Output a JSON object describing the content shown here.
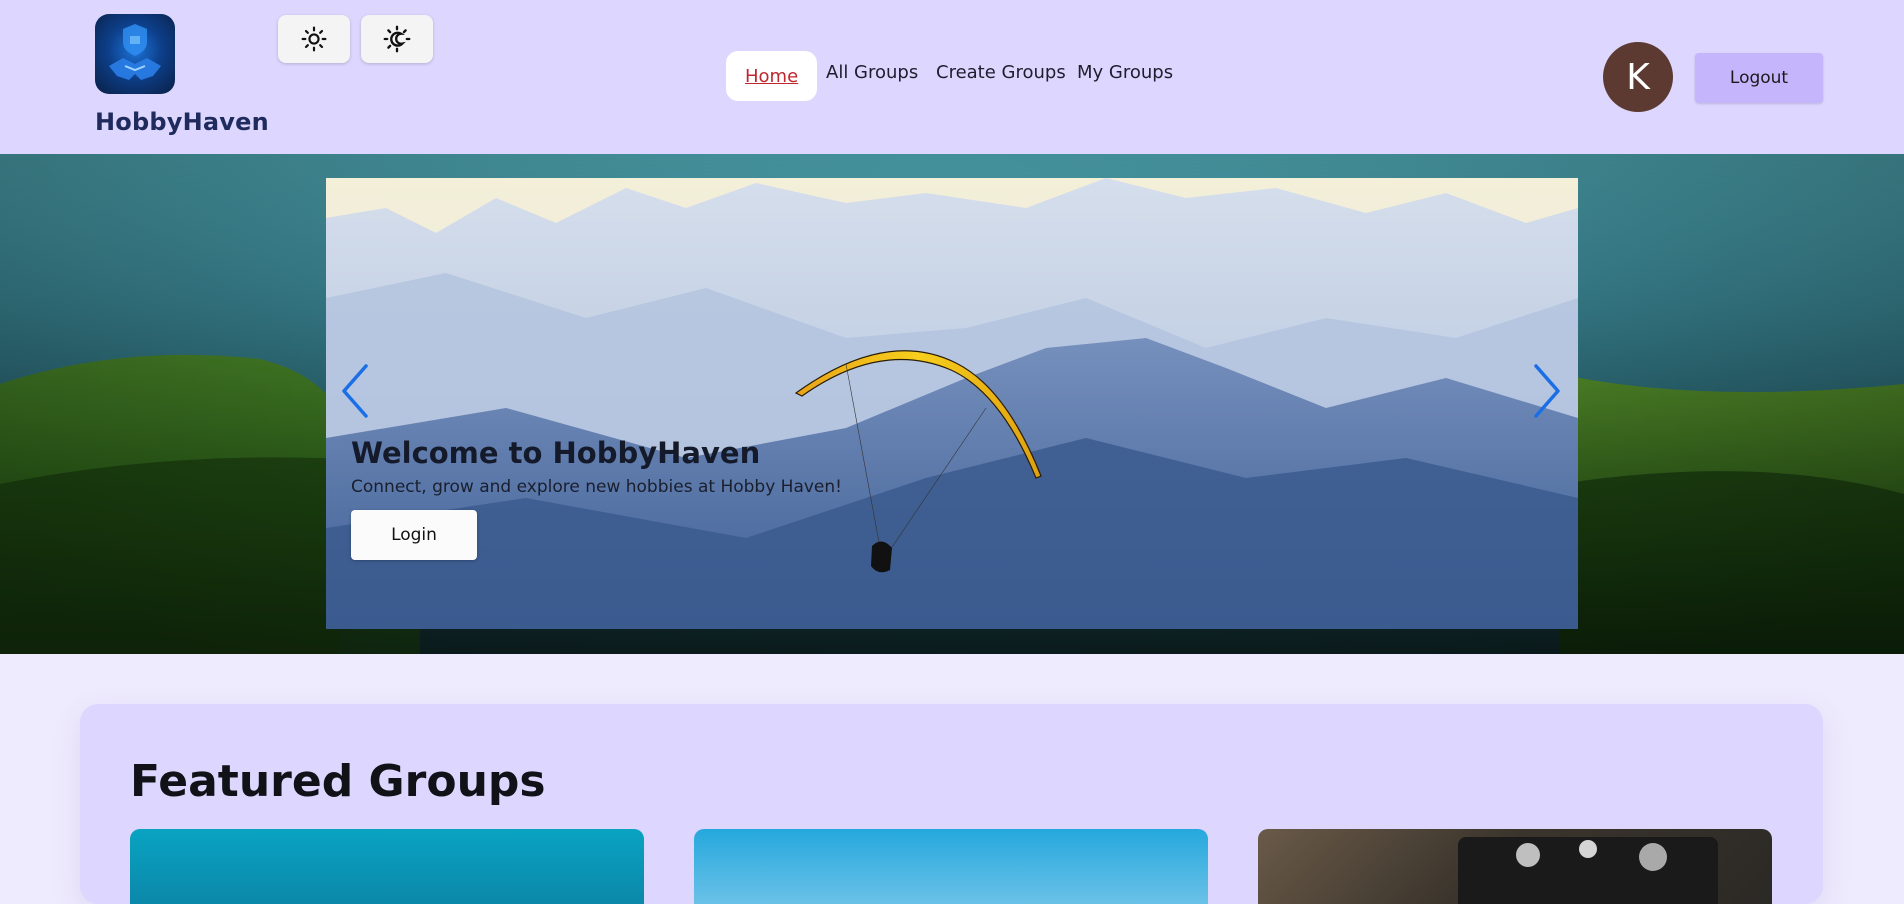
{
  "brand": {
    "name": "HobbyHaven",
    "logo_icon": "handshake-shield-icon"
  },
  "theme_toggles": [
    {
      "name": "light-mode-button",
      "icon": "sun-icon"
    },
    {
      "name": "dark-mode-button",
      "icon": "moon-sun-icon"
    }
  ],
  "nav": {
    "items": [
      {
        "label": "Home",
        "active": true
      },
      {
        "label": "All Groups",
        "active": false
      },
      {
        "label": "Create Groups",
        "active": false
      },
      {
        "label": "My Groups",
        "active": false
      }
    ]
  },
  "user": {
    "avatar_initial": "K",
    "logout_label": "Logout"
  },
  "hero": {
    "title": "Welcome to HobbyHaven",
    "subtitle": "Connect, grow and explore new hobbies at Hobby Haven!",
    "cta_label": "Login",
    "prev_icon": "chevron-left-icon",
    "next_icon": "chevron-right-icon"
  },
  "featured": {
    "title": "Featured Groups",
    "cards": [
      {
        "image": "ocean-image"
      },
      {
        "image": "sky-image"
      },
      {
        "image": "camera-image"
      }
    ]
  },
  "colors": {
    "header_bg": "#ddd6fe",
    "page_bg": "#efebfe",
    "logout_bg": "#c4b5fd",
    "active_link": "#c0262d",
    "arrow": "#1a6fe6",
    "avatar_bg": "#5d3a31"
  }
}
